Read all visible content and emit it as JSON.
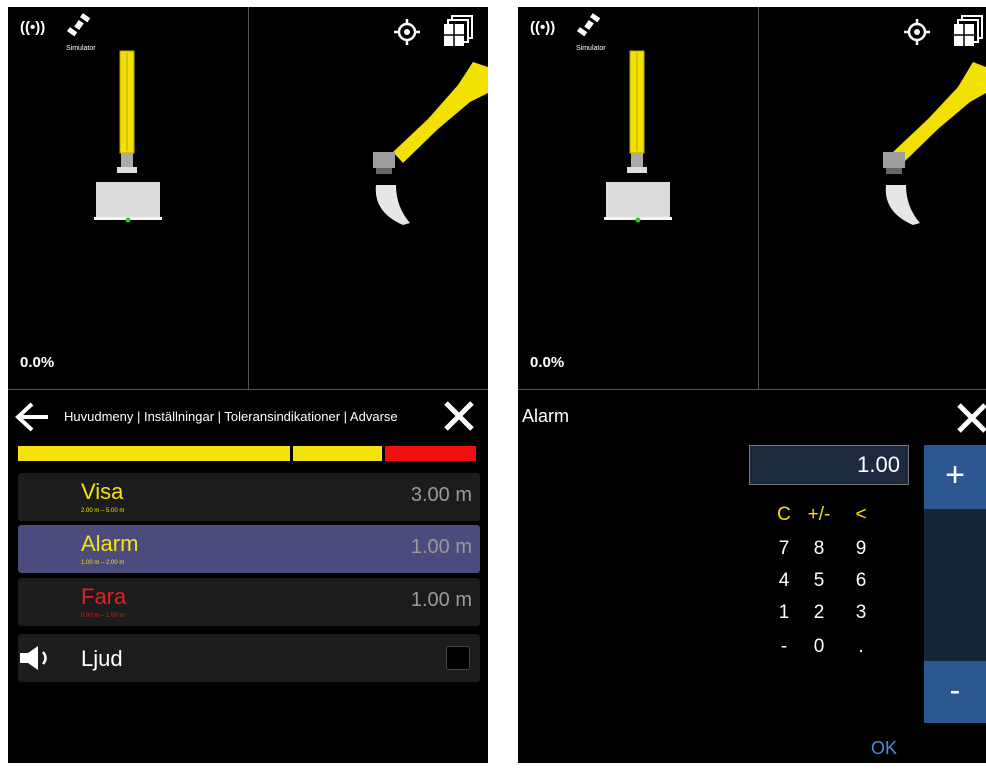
{
  "status": {
    "signal_icon": "wireless-signal-icon",
    "satellite_icon": "satellite-icon",
    "simulator_label": "Simulator",
    "target_icon": "target-icon",
    "layers_icon": "layers-icon",
    "signal_glyph": "((•))"
  },
  "viewport": {
    "grade": "0.0%"
  },
  "menu": {
    "breadcrumb": "Huvudmeny | Inställningar | Toleransindikationer | Advarse",
    "tolerance_colors": [
      "#f5e20a",
      "#f5e20a",
      "#f20f0f"
    ],
    "rows": [
      {
        "label": "Visa",
        "range": "2.00 m – 5.00 m",
        "value": "3.00 m",
        "color": "#f5e20a"
      },
      {
        "label": "Alarm",
        "range": "1.00 m – 2.00 m",
        "value": "1.00 m",
        "color": "#f5e20a"
      },
      {
        "label": "Fara",
        "range": "0.00 m – 1.00 m",
        "value": "1.00 m",
        "color": "#e51f1f"
      }
    ],
    "sound": {
      "label": "Ljud",
      "checked": false
    }
  },
  "numpad": {
    "title": "Alarm",
    "value": "1.00",
    "keys": [
      [
        "C",
        "+/-",
        "<"
      ],
      [
        "7",
        "8",
        "9"
      ],
      [
        "4",
        "5",
        "6"
      ],
      [
        "1",
        "2",
        "3"
      ],
      [
        "-",
        "0",
        "."
      ]
    ],
    "plus_label": "+",
    "minus_label": "-",
    "ok_label": "OK"
  },
  "colors": {
    "accent_yellow": "#f5e20a",
    "danger_red": "#e51f1f",
    "selected_row": "#4b4b7e",
    "button_blue": "#2c5791"
  }
}
